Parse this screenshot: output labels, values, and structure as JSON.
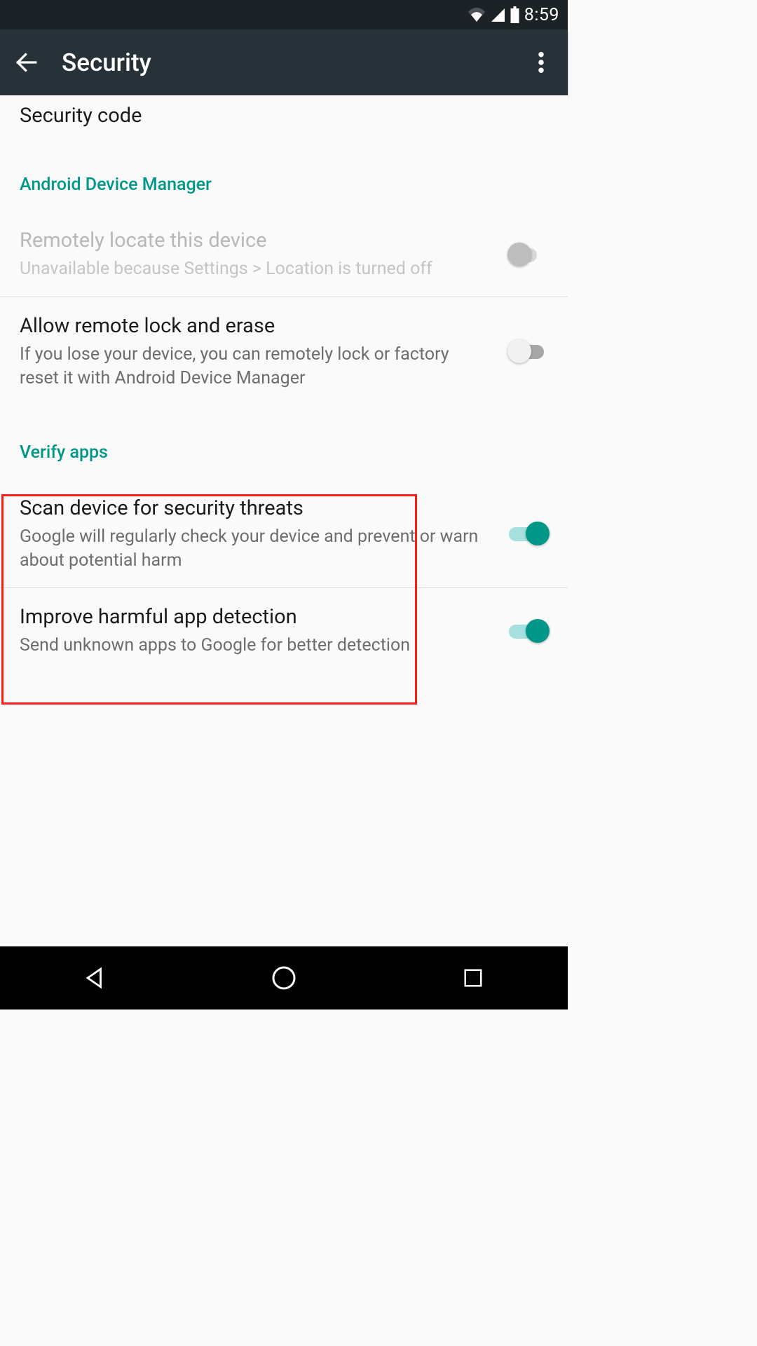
{
  "status": {
    "time": "8:59"
  },
  "appbar": {
    "title": "Security"
  },
  "partial_item": {
    "title": "Security code"
  },
  "category1": "Android Device Manager",
  "adm": {
    "locate": {
      "title": "Remotely locate this device",
      "summary": "Unavailable because Settings > Location is turned off"
    },
    "erase": {
      "title": "Allow remote lock and erase",
      "summary": "If you lose your device, you can remotely lock or factory reset it with Android Device Manager"
    }
  },
  "category2": "Verify apps",
  "verify": {
    "scan": {
      "title": "Scan device for security threats",
      "summary": "Google will regularly check your device and prevent or warn about potential harm"
    },
    "improve": {
      "title": "Improve harmful app detection",
      "summary": "Send unknown apps to Google for better detection"
    }
  },
  "colors": {
    "accent": "#009688",
    "appbar": "#263238"
  }
}
